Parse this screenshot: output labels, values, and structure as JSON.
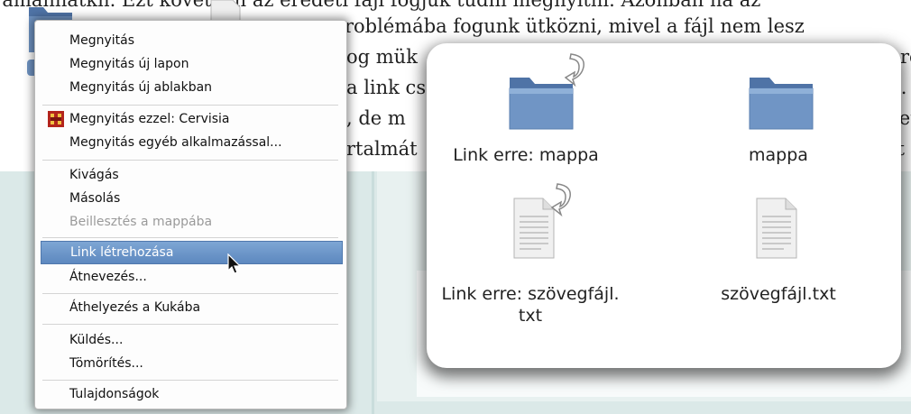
{
  "document": {
    "lines": [
      "Jamannatkn. Ezt követően az eredeti fájl fogjuk tudni megnyitni. Azonban ha az",
      "roblémába fogunk ütközni, mivel a fájl nem lesz",
      "og mük",
      "re-",
      "a link cs",
      "l.",
      ", de m",
      "ket",
      "rtalmát",
      "át"
    ]
  },
  "menu": {
    "items": [
      {
        "label": "Megnyitás"
      },
      {
        "label": "Megnyitás új lapon"
      },
      {
        "label": "Megnyitás új ablakban"
      },
      {
        "label": "Megnyitás ezzel: Cervisia",
        "icon": "cervisia-icon"
      },
      {
        "label": "Megnyitás egyéb alkalmazással..."
      },
      {
        "label": "Kivágás"
      },
      {
        "label": "Másolás"
      },
      {
        "label": "Beillesztés a mappába",
        "state": "disabled"
      },
      {
        "label": "Link létrehozása",
        "state": "highlighted"
      },
      {
        "label": "Átnevezés..."
      },
      {
        "label": "Áthelyezés a Kukába"
      },
      {
        "label": "Küldés..."
      },
      {
        "label": "Tömörítés..."
      },
      {
        "label": "Tulajdonságok"
      }
    ]
  },
  "file_view": {
    "items": [
      {
        "label": "Link erre: mappa",
        "icon": "folder-icon",
        "is_link": true
      },
      {
        "label": "mappa",
        "icon": "folder-icon",
        "is_link": false
      },
      {
        "label_line1": "Link erre: szövegfájl.",
        "label_line2": "txt",
        "icon": "text-file-icon",
        "is_link": true
      },
      {
        "label": "szövegfájl.txt",
        "icon": "text-file-icon",
        "is_link": false
      }
    ]
  },
  "colors": {
    "folder": "#6f93c2",
    "highlight": "#5d88bf",
    "band": "#dbe9e8"
  }
}
